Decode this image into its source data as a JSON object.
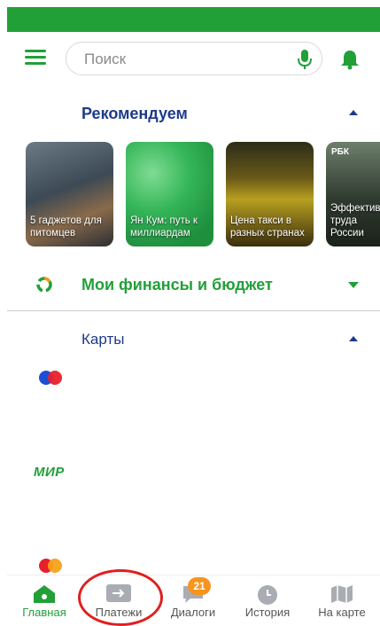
{
  "colors": {
    "brand_green": "#21a038",
    "title_blue": "#1e3a8a",
    "badge_orange": "#f7941d",
    "highlight_red": "#e0201f"
  },
  "header": {
    "menu_icon": "hamburger-icon",
    "bell_icon": "bell-icon",
    "mic_icon": "microphone-icon"
  },
  "search": {
    "placeholder": "Поиск"
  },
  "recommendations": {
    "title": "Рекомендуем",
    "stories": [
      {
        "label": "5 гаджетов для питомцев"
      },
      {
        "label": "Ян Кум: путь к миллиардам"
      },
      {
        "label": "Цена такси в разных странах"
      },
      {
        "label": "Эффективность труда России",
        "logo": "РБК"
      }
    ]
  },
  "finances": {
    "title": "Мои финансы и бюджет"
  },
  "cards": {
    "title": "Карты",
    "items": [
      {
        "type": "mastercard"
      },
      {
        "type": "mir",
        "logo": "МИР"
      },
      {
        "type": "mastercard"
      }
    ]
  },
  "bottom_nav": {
    "items": [
      {
        "label": "Главная",
        "icon": "home-icon",
        "active": true
      },
      {
        "label": "Платежи",
        "icon": "transfer-icon"
      },
      {
        "label": "Диалоги",
        "icon": "chat-icon",
        "badge": "21"
      },
      {
        "label": "История",
        "icon": "clock-icon"
      },
      {
        "label": "На карте",
        "icon": "map-icon"
      }
    ]
  }
}
